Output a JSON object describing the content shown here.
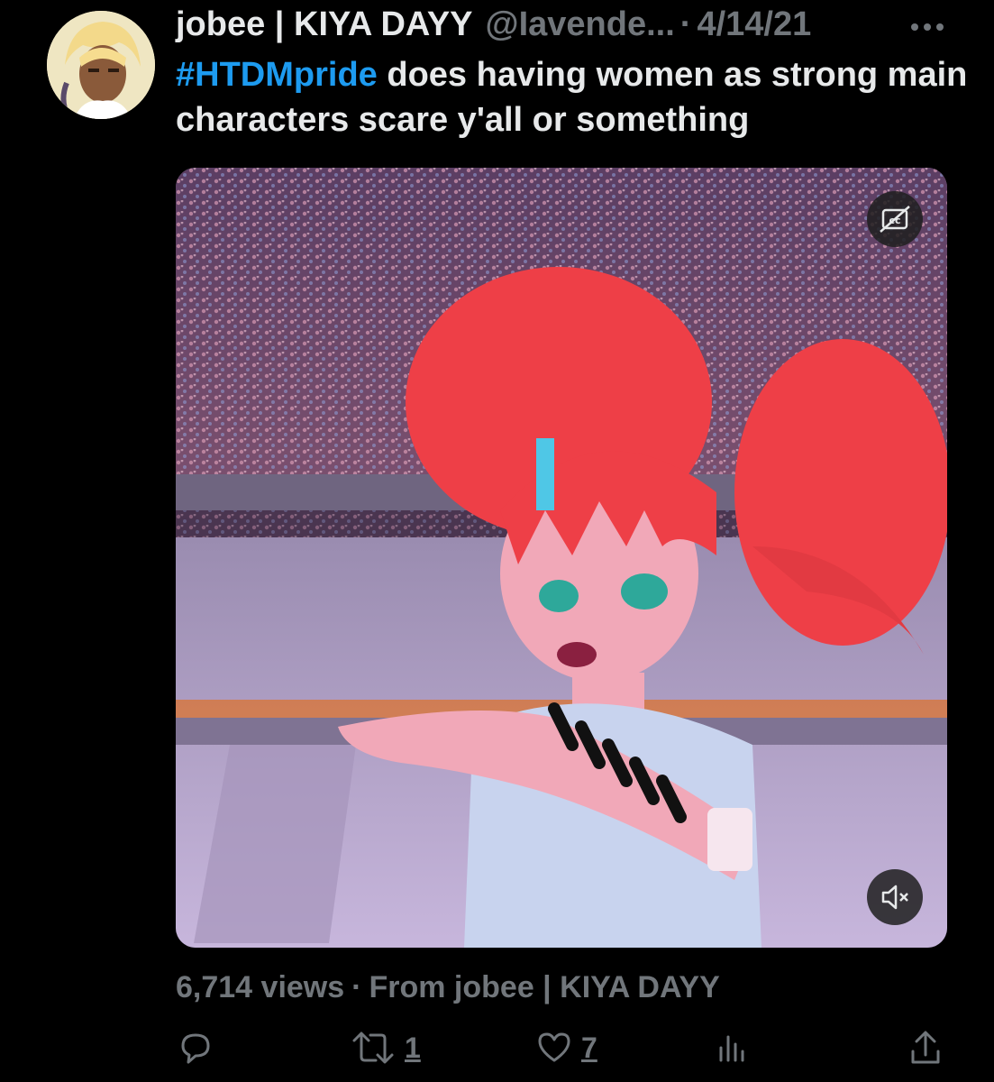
{
  "tweet": {
    "author_name": "jobee | KIYA DAYY",
    "handle": "@Iavende...",
    "separator": "·",
    "date": "4/14/21",
    "hashtag": "#HTDMpride",
    "text": " does having women as strong main characters scare y'all or something",
    "views": "6,714 views",
    "meta_separator": "·",
    "source": "From jobee | KIYA DAYY"
  },
  "actions": {
    "reply_count": "",
    "retweet_count": "1",
    "like_count": "7",
    "views_icon": "analytics-icon",
    "share_icon": "share-icon"
  },
  "media": {
    "type": "video",
    "captions_icon": "captions-off-icon",
    "mute_icon": "muted-speaker-icon"
  },
  "colors": {
    "background": "#000000",
    "primary_text": "#e7e9ea",
    "secondary_text": "#71767b",
    "link": "#1d9bf0"
  }
}
